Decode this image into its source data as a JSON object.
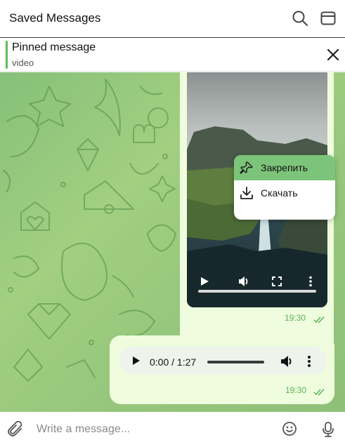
{
  "header": {
    "title": "Saved Messages",
    "icons": [
      "search-icon",
      "window-icon"
    ]
  },
  "pinned": {
    "title": "Pinned message",
    "subtitle": "video",
    "close_icon": "close-icon"
  },
  "messages": [
    {
      "type": "video",
      "time": "19:30",
      "status": "read",
      "controls": [
        "play-icon",
        "volume-icon",
        "fullscreen-icon",
        "more-icon"
      ]
    },
    {
      "type": "audio",
      "current_time": "0:00 / 1:27",
      "time": "19:30",
      "status": "read",
      "controls": [
        "play-icon",
        "volume-icon",
        "more-icon"
      ]
    }
  ],
  "context_menu": {
    "items": [
      {
        "label": "Закрепить",
        "icon": "pin-icon",
        "highlighted": true
      },
      {
        "label": "Скачать",
        "icon": "download-icon",
        "highlighted": false
      }
    ]
  },
  "composer": {
    "placeholder": "Write a message...",
    "icons": [
      "attach-icon",
      "emoji-icon",
      "mic-icon"
    ]
  },
  "colors": {
    "accent": "#5fbd5a",
    "bubble": "#effdde",
    "menu_highlight": "#7cc47a",
    "timestamp": "#5bb25a"
  }
}
